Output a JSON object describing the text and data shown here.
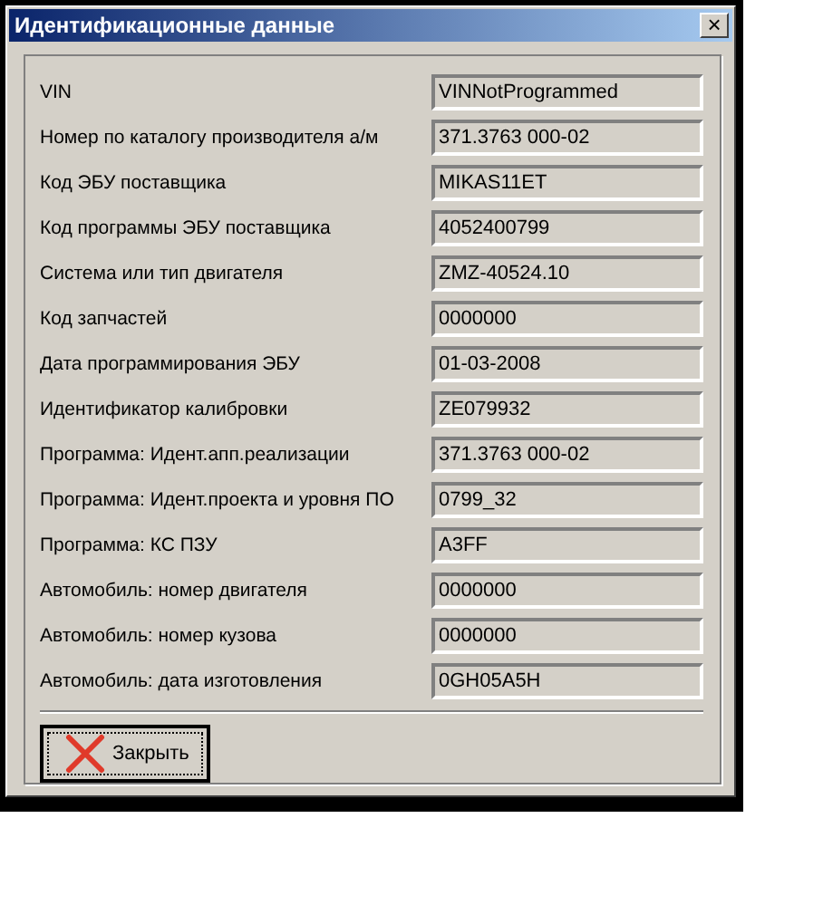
{
  "window": {
    "title": "Идентификационные данные",
    "close": "×"
  },
  "fields": [
    {
      "label": "VIN",
      "value": "VINNotProgrammed"
    },
    {
      "label": "Номер по каталогу производителя а/м",
      "value": "371.3763 000-02"
    },
    {
      "label": "Код ЭБУ поставщика",
      "value": "MIKAS11ET"
    },
    {
      "label": "Код программы ЭБУ поставщика",
      "value": "4052400799"
    },
    {
      "label": "Система или тип двигателя",
      "value": "ZMZ-40524.10"
    },
    {
      "label": "Код запчастей",
      "value": "0000000"
    },
    {
      "label": "Дата программирования ЭБУ",
      "value": "01-03-2008"
    },
    {
      "label": "Идентификатор калибровки",
      "value": "ZE079932"
    },
    {
      "label": "Программа: Идент.апп.реализации",
      "value": "371.3763 000-02"
    },
    {
      "label": "Программа: Идент.проекта и уровня ПО",
      "value": "0799_32"
    },
    {
      "label": "Программа: КС ПЗУ",
      "value": "A3FF"
    },
    {
      "label": "Автомобиль: номер двигателя",
      "value": "0000000"
    },
    {
      "label": "Автомобиль: номер кузова",
      "value": "0000000"
    },
    {
      "label": "Автомобиль: дата изготовления",
      "value": "0GH05A5H"
    }
  ],
  "buttons": [
    {
      "label": "Закрыть"
    }
  ]
}
